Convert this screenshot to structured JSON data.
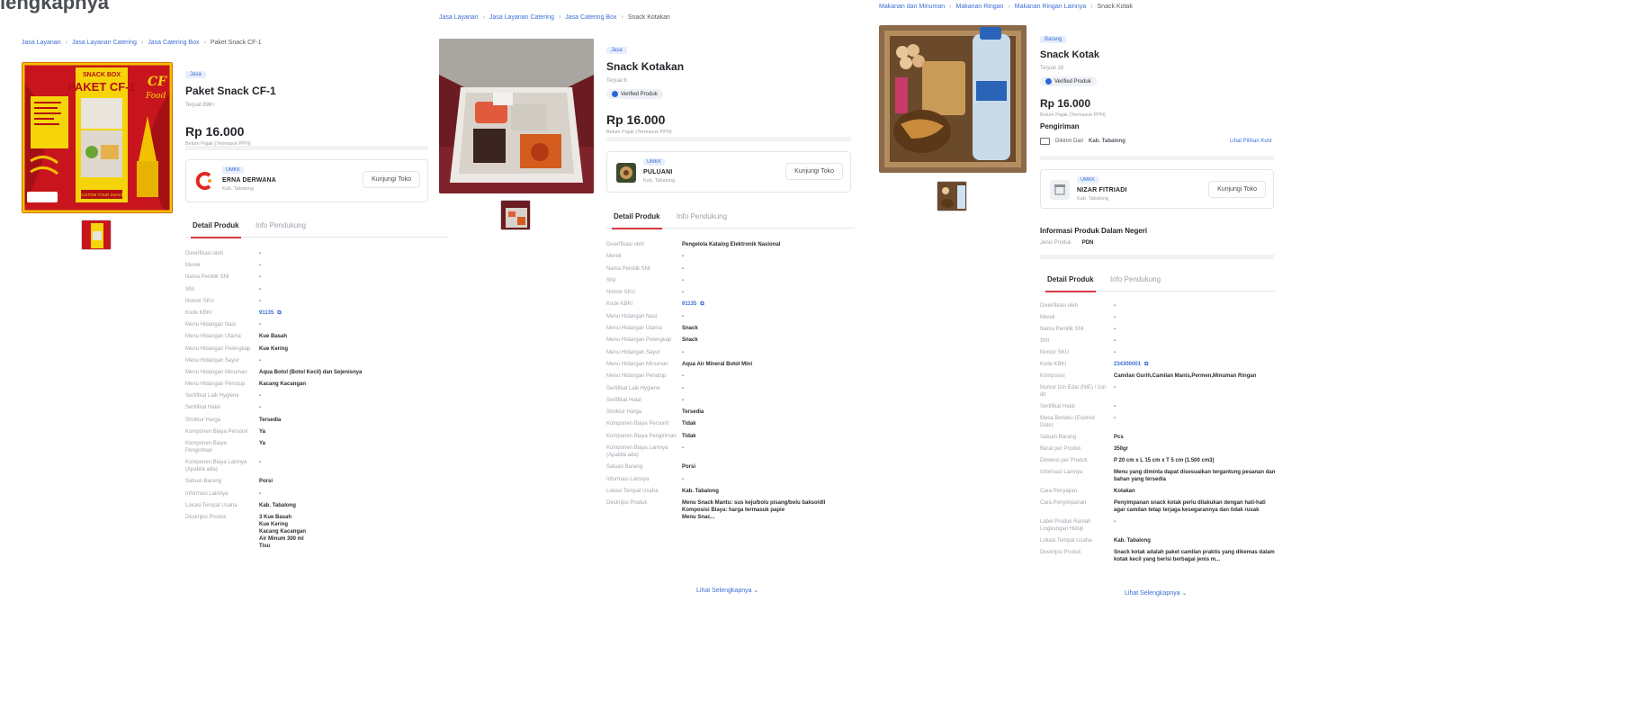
{
  "page": {
    "heading_fragment": "lengkapnya"
  },
  "panels": [
    {
      "breadcrumb": [
        "Jasa Layanan",
        "Jasa Layanan Catering",
        "Jasa Catering Box",
        "Paket Snack CF-1"
      ],
      "image_lettering": [
        "SNACK BOX",
        "PAKET CF-1",
        "CF",
        "Food",
        "CUSTOM YOUR SNACK"
      ],
      "badge": "Jasa",
      "title": "Paket Snack CF-1",
      "sold": "Terjual 898+",
      "price": "Rp 16.000",
      "price_note": "Belum Pajak (Termasuk PPN)",
      "store": {
        "badge": "UMKK",
        "name": "ERNA DERWANA",
        "location": "Kab. Tabalong",
        "visit_label": "Kunjungi Toko"
      },
      "tabs": [
        "Detail Produk",
        "Info Pendukung"
      ],
      "specs": [
        {
          "label": "Diverifikasi oleh",
          "value": "-"
        },
        {
          "label": "Merek",
          "value": "-"
        },
        {
          "label": "Nama Pemilik SNI",
          "value": "-"
        },
        {
          "label": "SNI",
          "value": "-"
        },
        {
          "label": "Nomor SKU",
          "value": "-"
        },
        {
          "label": "Kode KBKI",
          "value": "91135",
          "link": true
        },
        {
          "label": "Menu Hidangan Nasi",
          "value": "-"
        },
        {
          "label": "Menu Hidangan Utama",
          "value": "Kue Basah"
        },
        {
          "label": "Menu Hidangan Pelengkap",
          "value": "Kue Kering"
        },
        {
          "label": "Menu Hidangan Sayur",
          "value": "-"
        },
        {
          "label": "Menu Hidangan Minuman",
          "value": "Aqua Botol (Botol Kecil) dan Sejenisnya"
        },
        {
          "label": "Menu Hidangan Penutup",
          "value": "Kacang Kacangan"
        },
        {
          "label": "Sertifikat Laik Hygiene",
          "value": "-"
        },
        {
          "label": "Sertifikat Halal",
          "value": "-"
        },
        {
          "label": "Struktur Harga",
          "value": "Tersedia"
        },
        {
          "label": "Komponen Biaya Personil",
          "value": "Ya"
        },
        {
          "label": "Komponen Biaya Pengiriman",
          "value": "Ya"
        },
        {
          "label": "Komponen Biaya Lainnya (Apabila ada)",
          "value": "-"
        },
        {
          "label": "Satuan Barang",
          "value": "Porsi"
        },
        {
          "label": "Informasi Lainnya",
          "value": "-"
        },
        {
          "label": "Lokasi Tempat Usaha",
          "value": "Kab. Tabalong"
        },
        {
          "label": "Deskripsi Produk",
          "value": "3 Kue Basah\nKue Kering\nKacang Kacangan\nAir Minum 300 ml\nTisu"
        }
      ]
    },
    {
      "breadcrumb": [
        "Jasa Layanan",
        "Jasa Layanan Catering",
        "Jasa Catering Box",
        "Snack Kotakan"
      ],
      "badge": "Jasa",
      "title": "Snack Kotakan",
      "sold": "Terjual 6",
      "verified": "Verified Produk",
      "price": "Rp 16.000",
      "price_note": "Belum Pajak (Termasuk PPN)",
      "store": {
        "badge": "UMKK",
        "name": "PULUANI",
        "location": "Kab. Tabalong",
        "visit_label": "Kunjungi Toko"
      },
      "tabs": [
        "Detail Produk",
        "Info Pendukung"
      ],
      "specs": [
        {
          "label": "Diverifikasi oleh",
          "value": "Pengelola Katalog Elektronik Nasional"
        },
        {
          "label": "Merek",
          "value": "-"
        },
        {
          "label": "Nama Pemilik SNI",
          "value": "-"
        },
        {
          "label": "SNI",
          "value": "-"
        },
        {
          "label": "Nomor SKU",
          "value": "-"
        },
        {
          "label": "Kode KBKI",
          "value": "91135",
          "link": true
        },
        {
          "label": "Menu Hidangan Nasi",
          "value": "-"
        },
        {
          "label": "Menu Hidangan Utama",
          "value": "Snack"
        },
        {
          "label": "Menu Hidangan Pelengkap",
          "value": "Snack"
        },
        {
          "label": "Menu Hidangan Sayur",
          "value": "-"
        },
        {
          "label": "Menu Hidangan Minuman",
          "value": "Aqua Air Mineral Botol Mini"
        },
        {
          "label": "Menu Hidangan Penutup",
          "value": "-"
        },
        {
          "label": "Sertifikat Laik Hygiene",
          "value": "-"
        },
        {
          "label": "Sertifikat Halal",
          "value": "-"
        },
        {
          "label": "Struktur Harga",
          "value": "Tersedia"
        },
        {
          "label": "Komponen Biaya Personil",
          "value": "Tidak"
        },
        {
          "label": "Komponen Biaya Pengiriman",
          "value": "Tidak"
        },
        {
          "label": "Komponen Biaya Lainnya (Apabila ada)",
          "value": "-"
        },
        {
          "label": "Satuan Barang",
          "value": "Porsi"
        },
        {
          "label": "Informasi Lainnya",
          "value": "-"
        },
        {
          "label": "Lokasi Tempat Usaha",
          "value": "Kab. Tabalong"
        },
        {
          "label": "Deskripsi Produk",
          "value": "Menu Snack Mantu: sus keju/bolu pisang/bolu bakso/dll\nKomposisi Biaya: harga termasuk papie\nMenu Snac..."
        }
      ],
      "see_more": "Lihat Selengkapnya"
    },
    {
      "breadcrumb": [
        "Makanan dan Minuman",
        "Makanan Ringan",
        "Makanan Ringan Lainnya",
        "Snack Kotak"
      ],
      "badge": "Barang",
      "title": "Snack Kotak",
      "sold": "Terjual 16",
      "verified": "Verified Produk",
      "price": "Rp 16.000",
      "price_note": "Belum Pajak (Termasuk PPN)",
      "shipping": {
        "title": "Pengiriman",
        "text": "Dikirim Dari",
        "origin": "Kab. Tabalong",
        "link": "Lihat Pilihan Kurir"
      },
      "store": {
        "badge": "UMKK",
        "name": "NIZAR FITRIADI",
        "location": "Kab. Tabalong",
        "visit_label": "Kunjungi Toko"
      },
      "foreign": {
        "title": "Informasi Produk Dalam Negeri",
        "label": "Jenis Produk",
        "value": "PDN"
      },
      "tabs": [
        "Detail Produk",
        "Info Pendukung"
      ],
      "specs": [
        {
          "label": "Diverifikasi oleh",
          "value": "-"
        },
        {
          "label": "Merek",
          "value": "-"
        },
        {
          "label": "Nama Pemilik SNI",
          "value": "-"
        },
        {
          "label": "SNI",
          "value": "-"
        },
        {
          "label": "Nomor SKU",
          "value": "-"
        },
        {
          "label": "Kode KBKI",
          "value": "234300001",
          "link": true
        },
        {
          "label": "Komposisi",
          "value": "Camilan Gurih,Camilan Manis,Permen,Minuman Ringan"
        },
        {
          "label": "Nomor Izin Edar (NIE) / Izin dll",
          "value": "-"
        },
        {
          "label": "Sertifikat Halal",
          "value": "-"
        },
        {
          "label": "Masa Berlaku (Expired Date)",
          "value": "-"
        },
        {
          "label": "Satuan Barang",
          "value": "Pcs"
        },
        {
          "label": "Berat per Produk",
          "value": "350gr"
        },
        {
          "label": "Dimensi per Produk",
          "value": "P 20 cm x L 15 cm x T 5 cm (1.500 cm3)"
        },
        {
          "label": "Informasi Lainnya",
          "value": "Menu yang diminta dapat disesuaikan tergantung pesanan dan bahan yang tersedia"
        },
        {
          "label": "Cara Penyajian",
          "value": "Kotakan"
        },
        {
          "label": "Cara Penyimpanan",
          "value": "Penyimpanan snack kotak perlu dilakukan dengan hati-hati agar camilan tetap terjaga kesegarannya dan tidak rusak"
        },
        {
          "label": "Label Produk Ramah Lingkungan Hidup",
          "value": "-"
        },
        {
          "label": "Lokasi Tempat Usaha",
          "value": "Kab. Tabalong"
        },
        {
          "label": "Deskripsi Produk",
          "value": "Snack kotak adalah paket camilan praktis yang dikemas dalam kotak kecil yang berisi berbagai jenis m..."
        }
      ],
      "see_more": "Lihat Selengkapnya"
    }
  ]
}
